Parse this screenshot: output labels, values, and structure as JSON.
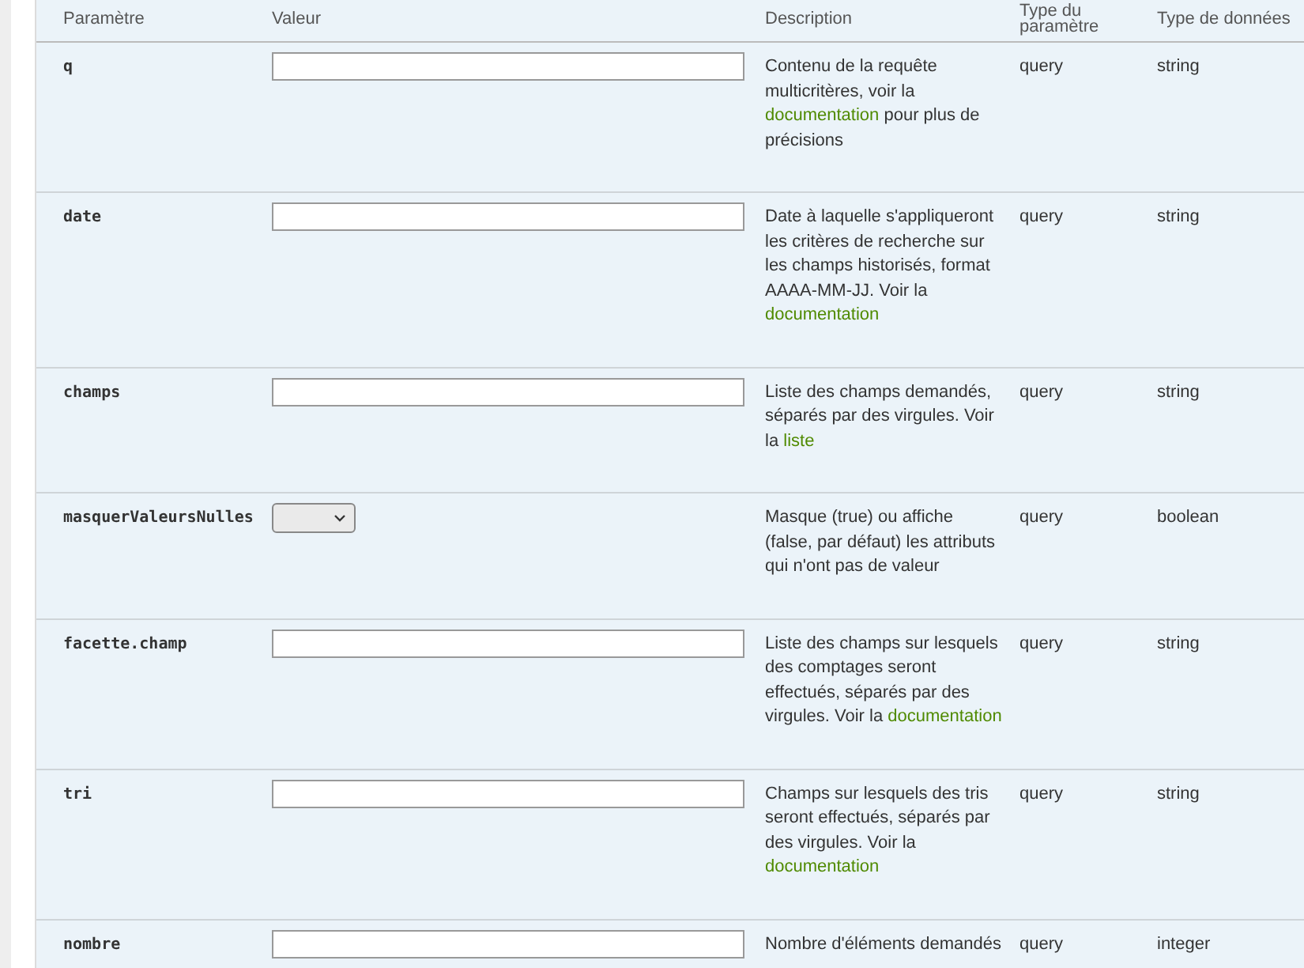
{
  "table": {
    "columns": [
      "Paramètre",
      "Valeur",
      "Description",
      "Type du paramètre",
      "Type de données"
    ],
    "rows": [
      {
        "name": "q",
        "kind": "text",
        "description": [
          {
            "text": "Contenu de la requête multicritères, voir la "
          },
          {
            "text": "documentation",
            "kind": "link"
          },
          {
            "text": " pour plus de précisions"
          }
        ],
        "param_type": "query",
        "data_type": "string"
      },
      {
        "name": "date",
        "kind": "text",
        "description": [
          {
            "text": "Date à laquelle s'appliqueront les critères de recherche sur les champs historisés, format AAAA-MM-JJ. Voir la "
          },
          {
            "text": "documentation",
            "kind": "link"
          }
        ],
        "param_type": "query",
        "data_type": "string"
      },
      {
        "name": "champs",
        "kind": "text",
        "description": [
          {
            "text": "Liste des champs demandés, séparés par des virgules. Voir la "
          },
          {
            "text": "liste",
            "kind": "link"
          }
        ],
        "param_type": "query",
        "data_type": "string"
      },
      {
        "name": "masquerValeursNulles",
        "kind": "select",
        "description": [
          {
            "text": "Masque (true) ou affiche (false, par défaut) les attributs qui n'ont pas de valeur"
          }
        ],
        "param_type": "query",
        "data_type": "boolean"
      },
      {
        "name": "facette.champ",
        "kind": "text",
        "description": [
          {
            "text": "Liste des champs sur lesquels des comptages seront effectués, séparés par des virgules. Voir la "
          },
          {
            "text": "documentation",
            "kind": "link"
          }
        ],
        "param_type": "query",
        "data_type": "string"
      },
      {
        "name": "tri",
        "kind": "text",
        "description": [
          {
            "text": "Champs sur lesquels des tris seront effectués, séparés par des virgules. Voir la "
          },
          {
            "text": "documentation",
            "kind": "link"
          }
        ],
        "param_type": "query",
        "data_type": "string"
      },
      {
        "name": "nombre",
        "kind": "text",
        "description": [
          {
            "text": "Nombre d'éléments demandés"
          }
        ],
        "param_type": "query",
        "data_type": "integer"
      }
    ]
  }
}
